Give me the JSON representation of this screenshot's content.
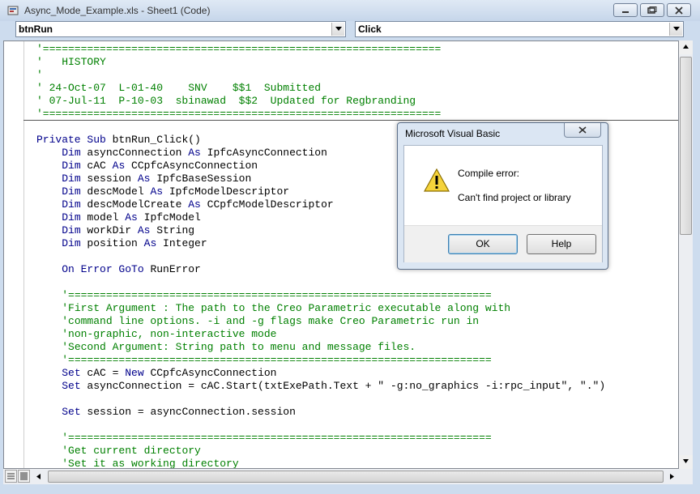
{
  "window": {
    "title": "Async_Mode_Example.xls - Sheet1 (Code)"
  },
  "object_combo": {
    "value": "btnRun"
  },
  "procedure_combo": {
    "value": "Click"
  },
  "header_lines": [
    "'===============================================================",
    "'   HISTORY",
    "'",
    "' 24-Oct-07  L-01-40    SNV    $$1  Submitted",
    "' 07-Jul-11  P-10-03  sbinawad  $$2  Updated for Regbranding",
    "'==============================================================="
  ],
  "code": [
    {
      "kind": "kw-sub",
      "pre": "Private Sub",
      "rest": " btnRun_Click()"
    },
    {
      "kind": "dim",
      "name": "asyncConnection",
      "type": "IpfcAsyncConnection"
    },
    {
      "kind": "dim",
      "name": "cAC",
      "type": "CCpfcAsyncConnection"
    },
    {
      "kind": "dim",
      "name": "session",
      "type": "IpfcBaseSession"
    },
    {
      "kind": "dim",
      "name": "descModel",
      "type": "IpfcModelDescriptor"
    },
    {
      "kind": "dim",
      "name": "descModelCreate",
      "type": "CCpfcModelDescriptor"
    },
    {
      "kind": "dim",
      "name": "model",
      "type": "IpfcModel"
    },
    {
      "kind": "dim",
      "name": "workDir",
      "type": "String"
    },
    {
      "kind": "dim",
      "name": "position",
      "type": "Integer"
    },
    {
      "kind": "blank"
    },
    {
      "kind": "onerror",
      "text": "On Error GoTo",
      "rest": " RunError"
    },
    {
      "kind": "blank"
    },
    {
      "kind": "comment",
      "text": "'==================================================================="
    },
    {
      "kind": "comment",
      "text": "'First Argument : The path to the Creo Parametric executable along with"
    },
    {
      "kind": "comment",
      "text": "'command line options. -i and -g flags make Creo Parametric run in"
    },
    {
      "kind": "comment",
      "text": "'non-graphic, non-interactive mode"
    },
    {
      "kind": "comment",
      "text": "'Second Argument: String path to menu and message files."
    },
    {
      "kind": "comment",
      "text": "'==================================================================="
    },
    {
      "kind": "set-new",
      "a": "Set",
      "b": " cAC = ",
      "c": "New",
      "d": " CCpfcAsyncConnection"
    },
    {
      "kind": "set",
      "a": "Set",
      "b": " asyncConnection = cAC.Start(txtExePath.Text + \" -g:no_graphics -i:rpc_input\", \".\")"
    },
    {
      "kind": "blank"
    },
    {
      "kind": "set",
      "a": "Set",
      "b": " session = asyncConnection.session"
    },
    {
      "kind": "blank"
    },
    {
      "kind": "comment",
      "text": "'==================================================================="
    },
    {
      "kind": "comment",
      "text": "'Get current directory"
    },
    {
      "kind": "comment",
      "text": "'Set it as working directory"
    }
  ],
  "dialog": {
    "title": "Microsoft Visual Basic",
    "message_title": "Compile error:",
    "message_body": "Can't find project or library",
    "ok_label": "OK",
    "help_label": "Help"
  },
  "keywords": {
    "dim": "Dim",
    "as": "As"
  },
  "colors": {
    "keyword": "#00008b",
    "comment": "#008000",
    "titlebar": "#c6d6ea"
  }
}
